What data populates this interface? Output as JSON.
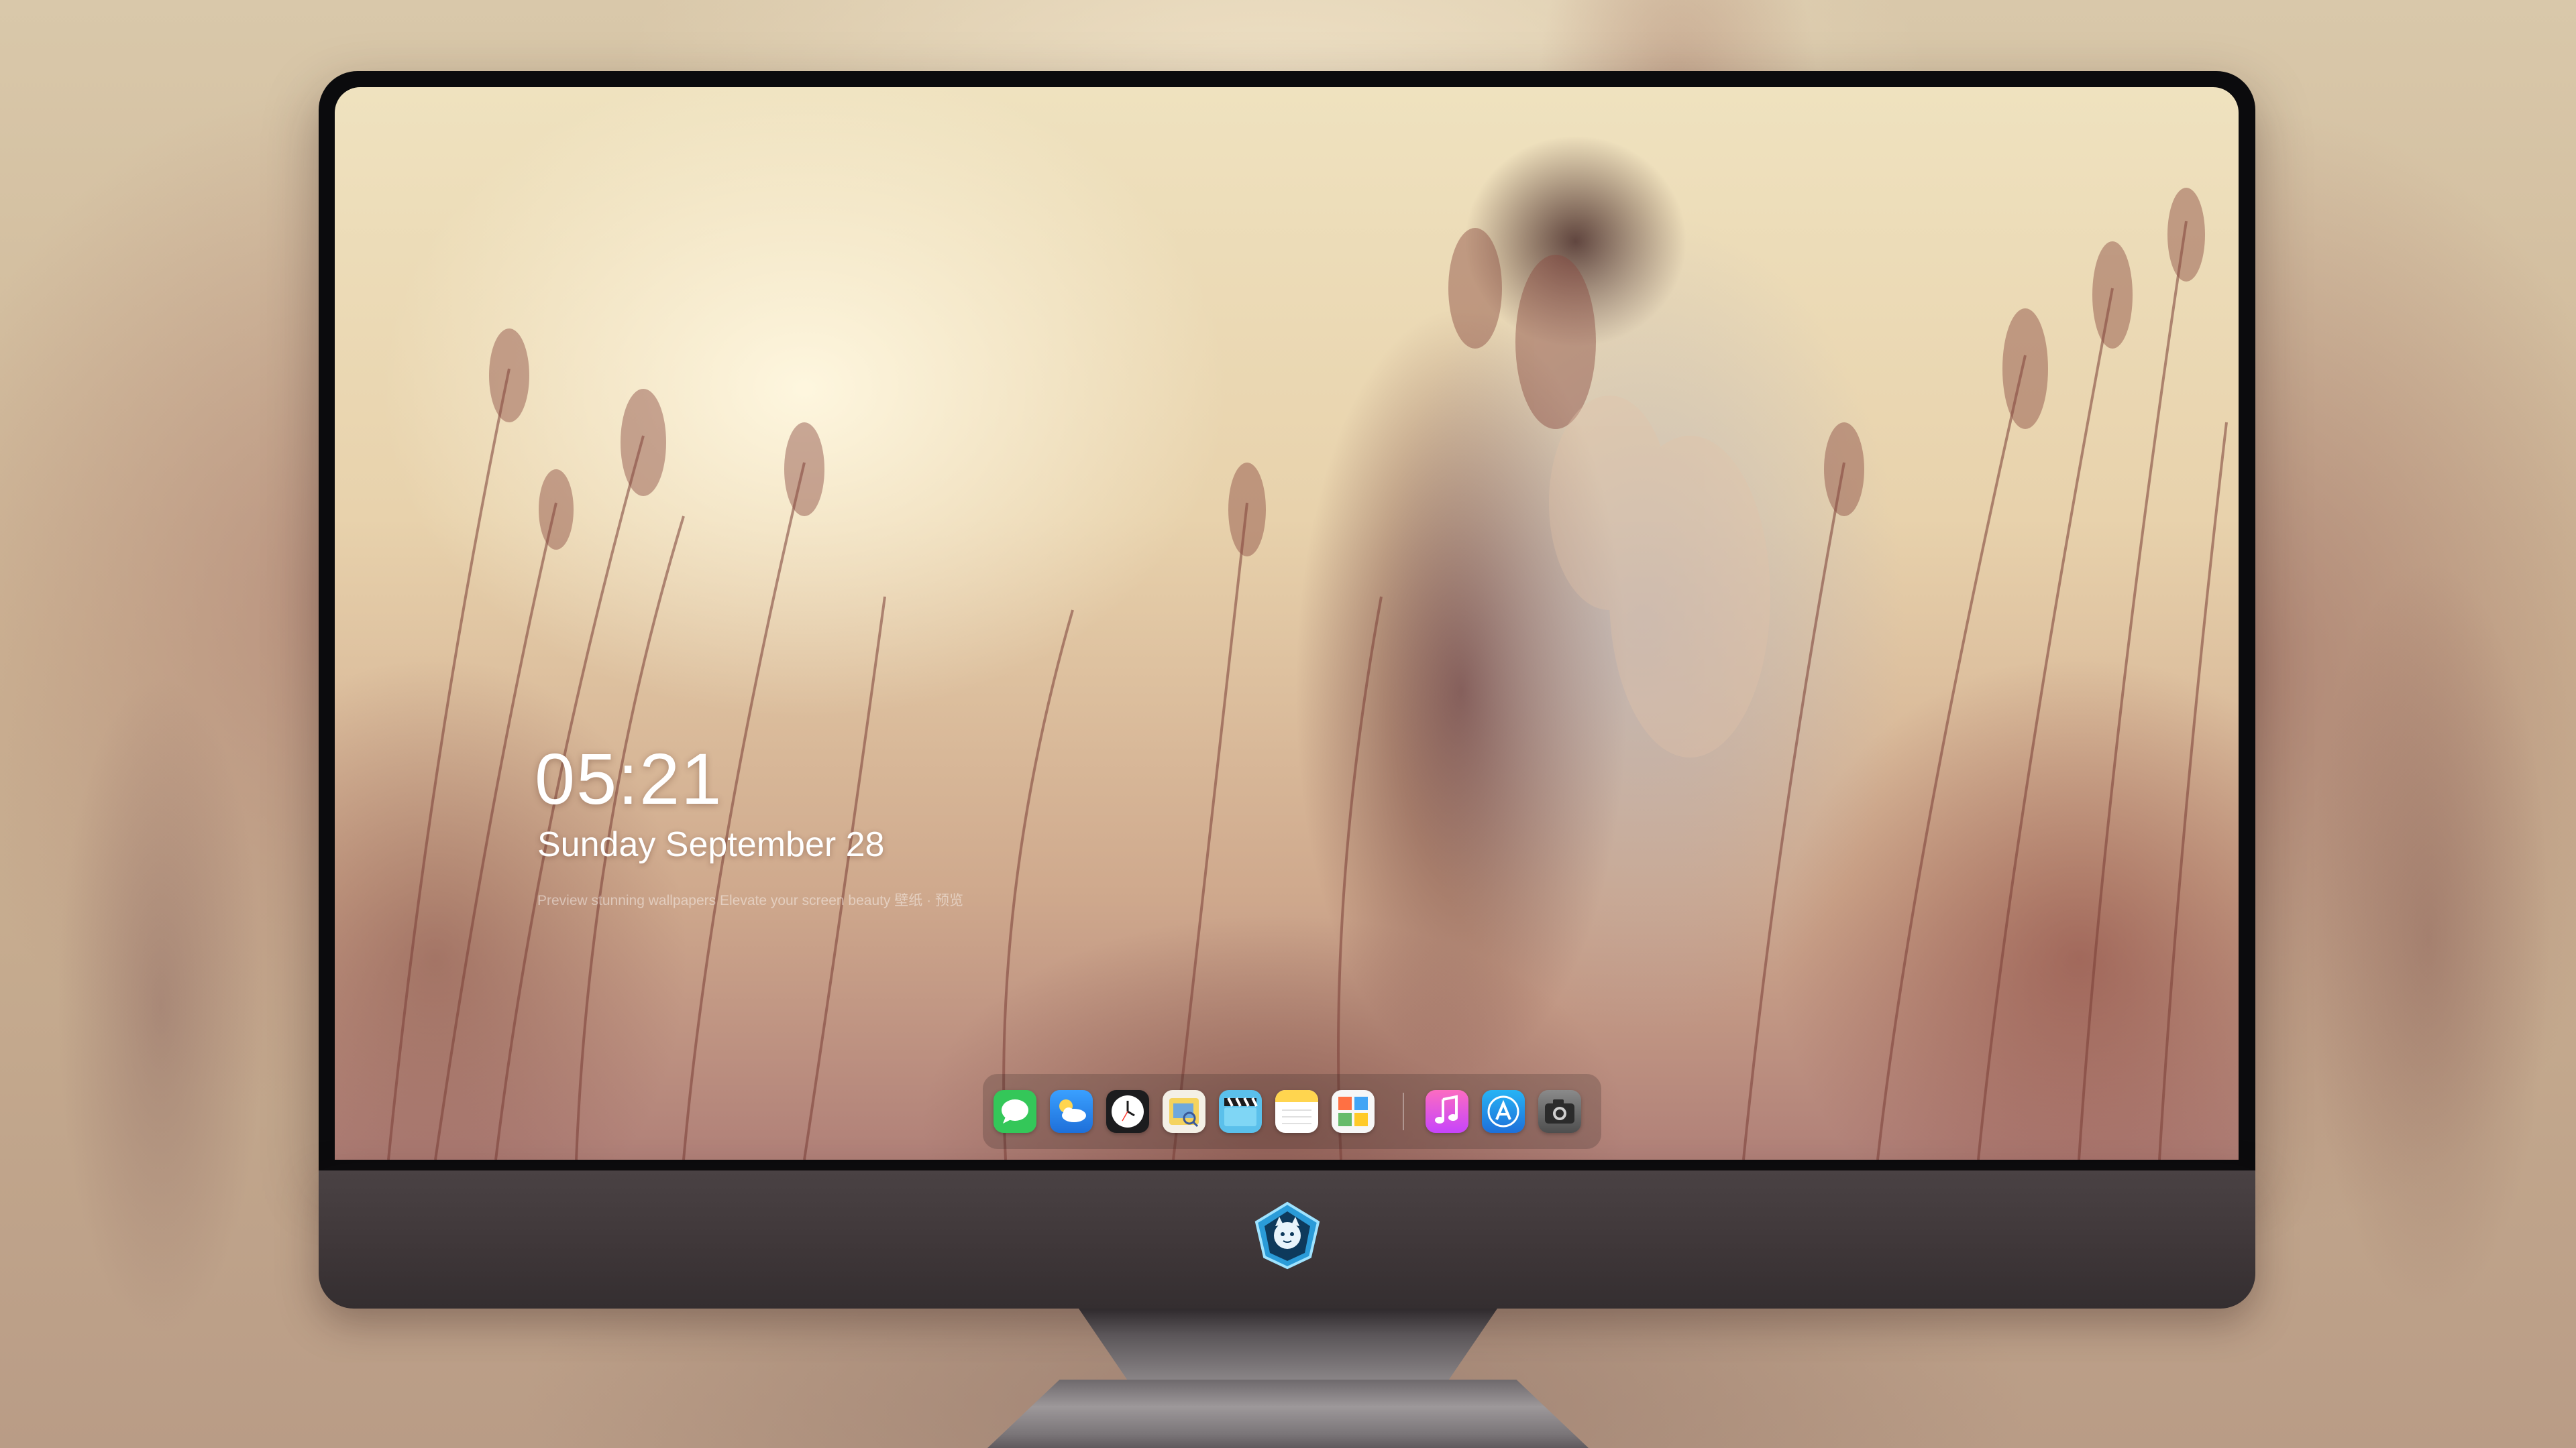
{
  "lockscreen": {
    "time": "05:21",
    "date": "Sunday September  28",
    "caption": "Preview stunning wallpapers  Elevate your screen beauty  壁纸 · 预览"
  },
  "dock": {
    "apps": [
      {
        "name": "Messages",
        "icon": "messages-icon",
        "color": "#34c759"
      },
      {
        "name": "Weather",
        "icon": "weather-icon",
        "color": "#2f8cf0"
      },
      {
        "name": "Clock",
        "icon": "clock-icon",
        "color": "#1c1c1e"
      },
      {
        "name": "Preview",
        "icon": "preview-icon",
        "color": "#f4d35e"
      },
      {
        "name": "Video Editor",
        "icon": "clapperboard-icon",
        "color": "#5bc0eb"
      },
      {
        "name": "Notes",
        "icon": "notes-icon",
        "color": "#ffd54f"
      },
      {
        "name": "Photo Booth",
        "icon": "photos-grid-icon",
        "color": "#f7f7f7"
      },
      {
        "name": "Music",
        "icon": "music-icon",
        "color": "#fb5fb0"
      },
      {
        "name": "App Store",
        "icon": "app-store-icon",
        "color": "#1e88e5"
      },
      {
        "name": "Camera",
        "icon": "camera-icon",
        "color": "#6b6b6b"
      }
    ]
  },
  "colors": {
    "bezel": "#0b0b0d",
    "chin": "#3f3739",
    "text": "#ffffff"
  }
}
